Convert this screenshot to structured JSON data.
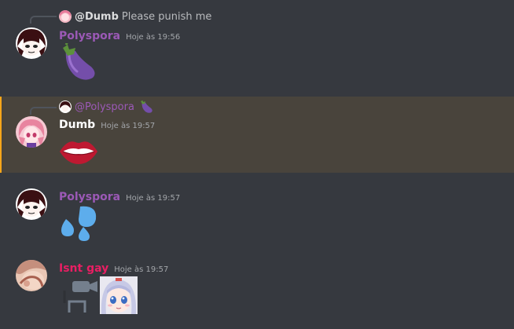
{
  "colors": {
    "background": "#36393f",
    "highlight": "#49443c",
    "mention_bar": "#faa61a",
    "polyspora": "#9b59b6",
    "dumb": "#ffffff",
    "isnt_gay": "#e91e63"
  },
  "messages": [
    {
      "reply": {
        "name": "@Dumb",
        "text": "Please punish me"
      },
      "author": "Polyspora",
      "time": "Hoje às 19:56",
      "emoji": "eggplant"
    },
    {
      "reply": {
        "name": "@Polyspora",
        "emoji": "eggplant"
      },
      "author": "Dumb",
      "time": "Hoje às 19:57",
      "emoji": "lips",
      "highlighted": true
    },
    {
      "author": "Polyspora",
      "time": "Hoje às 19:57",
      "emoji": "sweat-droplets"
    },
    {
      "author": "Isnt gay",
      "time": "Hoje às 19:57",
      "attachments": [
        "video-camera-placeholder",
        "anime-girl-image"
      ]
    }
  ]
}
